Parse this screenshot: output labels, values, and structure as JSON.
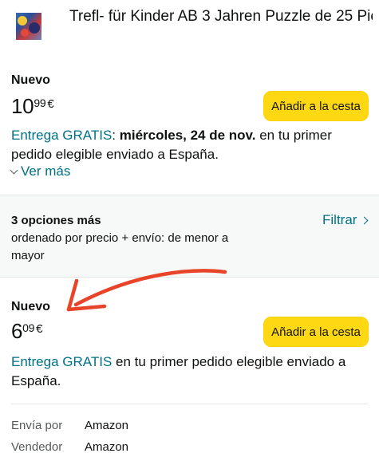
{
  "product": {
    "title": "Trefl- für Kinder AB 3 Jahren Puzzle de 25 Pie..."
  },
  "offers": [
    {
      "condition": "Nuevo",
      "price_whole": "10",
      "price_cents": "99",
      "currency": "€",
      "add_to_cart_label": "Añadir a la cesta",
      "delivery_label": "Entrega GRATIS",
      "delivery_colon": ":",
      "delivery_date": "miércoles, 24 de nov.",
      "delivery_rest": "en tu primer pedido elegible enviado a España.",
      "see_more_label": "Ver más"
    },
    {
      "condition": "Nuevo",
      "price_whole": "6",
      "price_cents": "09",
      "currency": "€",
      "add_to_cart_label": "Añadir a la cesta",
      "delivery_label": "Entrega GRATIS",
      "delivery_rest": "en tu primer pedido elegible enviado a España.",
      "ships_from_label": "Envía por",
      "ships_from_value": "Amazon",
      "seller_label": "Vendedor",
      "seller_value": "Amazon"
    }
  ],
  "options_bar": {
    "title": "3 opciones más",
    "subtitle": "ordenado por precio + envío: de menor a mayor",
    "filter_label": "Filtrar"
  },
  "annotation": {
    "arrow_color": "#e8442a"
  },
  "colors": {
    "button_yellow": "#ffd814",
    "link_teal": "#007185"
  }
}
